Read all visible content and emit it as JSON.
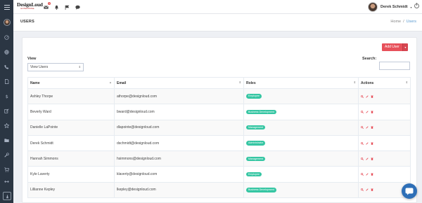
{
  "app": {
    "logo_text": "DesignLoud",
    "logo_tagline": "ENTERPRISE"
  },
  "topbar": {
    "notification_count": "3",
    "user_name": "Derek Schmidt"
  },
  "page": {
    "title": "USERS",
    "breadcrumb": [
      "Home",
      "/",
      "Users"
    ]
  },
  "toolbar": {
    "add_user_label": "Add User"
  },
  "filters": {
    "view_label": "View",
    "view_selected": "View Users",
    "search_label": "Search:",
    "search_value": ""
  },
  "table": {
    "columns": [
      "Name",
      "Email",
      "Roles",
      "Actions"
    ],
    "rows": [
      {
        "name": "Ashley Thorpe",
        "email": "athorpe@designloud.com",
        "role": "Employee"
      },
      {
        "name": "Beverly Ward",
        "email": "bward@designloud.com",
        "role": "Business Development"
      },
      {
        "name": "Danielle LaPointe",
        "email": "dlapointe@designloud.com",
        "role": "Management"
      },
      {
        "name": "Derek Schmidt",
        "email": "dschmidt@designloud.com",
        "role": "Administrator"
      },
      {
        "name": "Hannah Simmons",
        "email": "hsimmons@designloud.com",
        "role": "Management"
      },
      {
        "name": "Kyle Laverty",
        "email": "klaverty@designloud.com",
        "role": "Employee"
      },
      {
        "name": "Lillianne Kepley",
        "email": "lkepley@designloud.com",
        "role": "Business Development"
      }
    ]
  },
  "colors": {
    "sidebar_bg": "#2b3643",
    "accent_red": "#e7505a",
    "role_badge": "#36c6a3",
    "chat_blue": "#2e6fb7"
  }
}
